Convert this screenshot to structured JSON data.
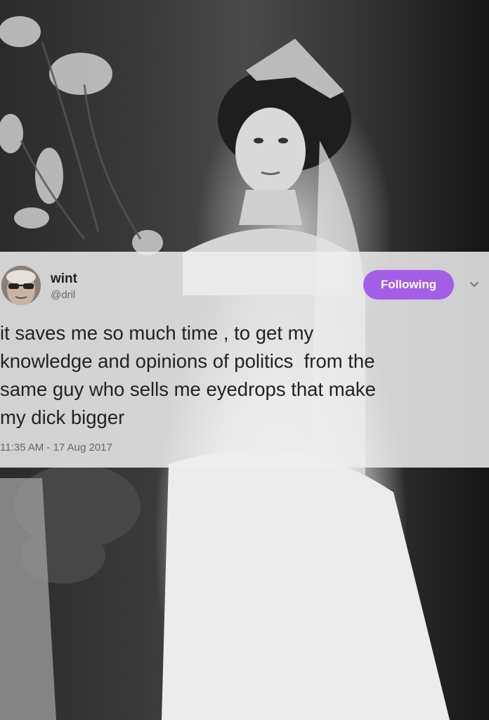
{
  "tweet": {
    "display_name": "wint",
    "handle": "@dril",
    "follow_label": "Following",
    "text": "it saves me so much time , to get my\nknowledge and opinions of politics  from the\nsame guy who sells me eyedrops that make\nmy dick bigger",
    "timestamp": "11:35 AM - 17 Aug 2017"
  },
  "icons": {
    "avatar": "avatar-photo",
    "menu": "chevron-down-icon"
  },
  "colors": {
    "follow_button": "#a45ee6",
    "overlay": "#eeeeee",
    "text": "#222222",
    "muted": "#666666"
  }
}
